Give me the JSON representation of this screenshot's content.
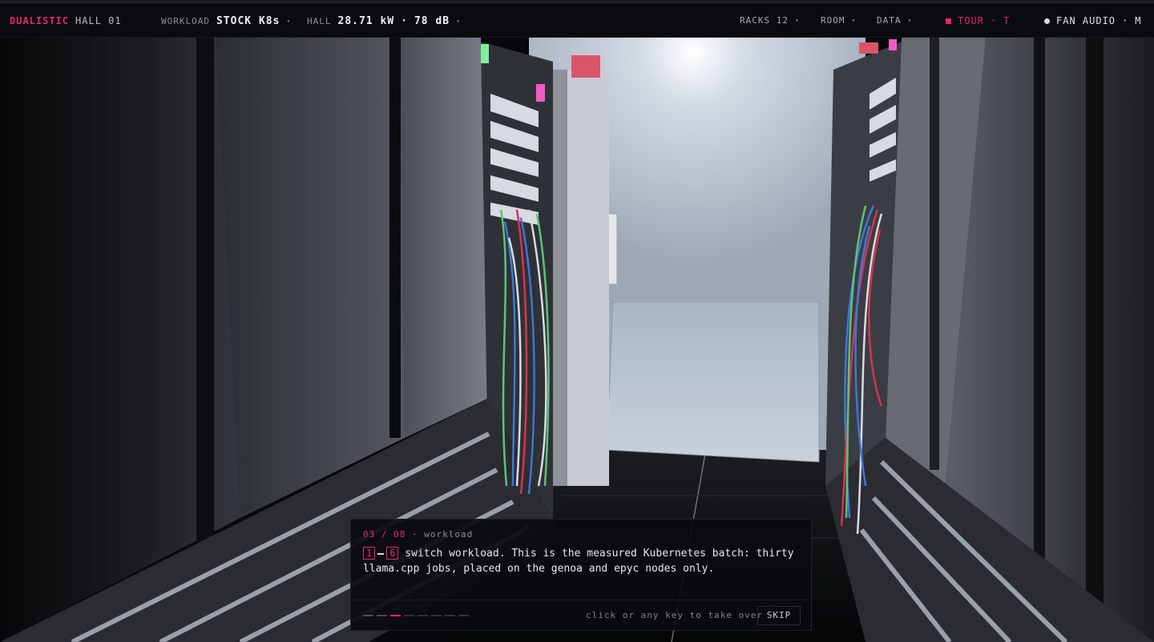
{
  "topbar": {
    "brand": "DUALISTIC",
    "hall_name": "HALL 01",
    "workload_label": "WORKLOAD",
    "workload_value": "STOCK K8s",
    "hall_label": "HALL",
    "hall_power": "28.71 kW",
    "separator": "·",
    "hall_noise": "78 dB",
    "caret": "▾",
    "racks_menu": "RACKS 12",
    "room_menu": "ROOM",
    "data_menu": "DATA",
    "tour_label": "TOUR",
    "tour_key": "T",
    "fan_audio_label": "FAN AUDIO",
    "fan_audio_key": "M"
  },
  "tour": {
    "step": "03 / 08",
    "separator": "·",
    "section": "workload",
    "key_from": "1",
    "key_to": "6",
    "body": "switch workload. This is the measured Kubernetes batch: thirty llama.cpp jobs, placed on the genoa and epyc nodes only.",
    "hint": "click or any key to take over",
    "skip_label": "SKIP",
    "progress": {
      "current": 3,
      "total": 8
    }
  },
  "colors": {
    "accent": "#e8266f",
    "background": "#07080b",
    "cable_green": "#5ec27a",
    "cable_blue": "#3d78d6",
    "cable_red": "#d8344c",
    "cable_white": "#d8dce4"
  }
}
